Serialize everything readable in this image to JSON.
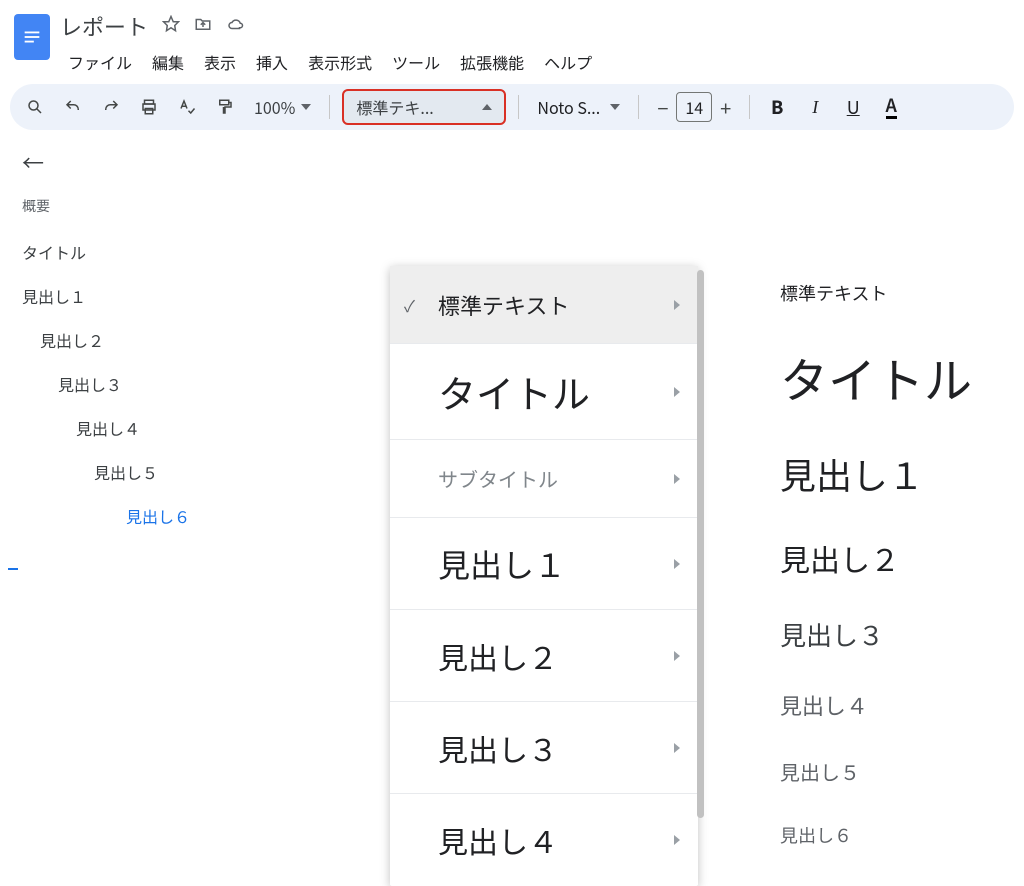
{
  "doc": {
    "title": "レポート"
  },
  "menubar": {
    "items": [
      "ファイル",
      "編集",
      "表示",
      "挿入",
      "表示形式",
      "ツール",
      "拡張機能",
      "ヘルプ"
    ]
  },
  "toolbar": {
    "zoom": "100%",
    "styles_label": "標準テキ...",
    "font_label": "Noto S...",
    "font_size": "14"
  },
  "outline": {
    "summary_label": "概要",
    "items": [
      {
        "label": "タイトル",
        "level": 1
      },
      {
        "label": "見出し１",
        "level": 1
      },
      {
        "label": "見出し２",
        "level": 2
      },
      {
        "label": "見出し３",
        "level": 3
      },
      {
        "label": "見出し４",
        "level": 4
      },
      {
        "label": "見出し５",
        "level": 5
      },
      {
        "label": "見出し６",
        "level": 6
      }
    ]
  },
  "styles_menu": {
    "items": [
      {
        "label": "標準テキスト",
        "cls": "sm-normal",
        "selected": true
      },
      {
        "label": "タイトル",
        "cls": "sm-title"
      },
      {
        "label": "サブタイトル",
        "cls": "sm-subtitle"
      },
      {
        "label": "見出し１",
        "cls": "sm-h1"
      },
      {
        "label": "見出し２",
        "cls": "sm-h2"
      },
      {
        "label": "見出し３",
        "cls": "sm-h3"
      },
      {
        "label": "見出し４",
        "cls": "sm-h4"
      }
    ]
  },
  "document": {
    "blocks": [
      {
        "text": "標準テキスト",
        "cls": "dc-normal"
      },
      {
        "text": "タイトル",
        "cls": "dc-title"
      },
      {
        "text": "見出し１",
        "cls": "dc-h1"
      },
      {
        "text": "見出し２",
        "cls": "dc-h2"
      },
      {
        "text": "見出し３",
        "cls": "dc-h3"
      },
      {
        "text": "見出し４",
        "cls": "dc-h4"
      },
      {
        "text": "見出し５",
        "cls": "dc-h5"
      },
      {
        "text": "見出し６",
        "cls": "dc-h6"
      }
    ]
  }
}
